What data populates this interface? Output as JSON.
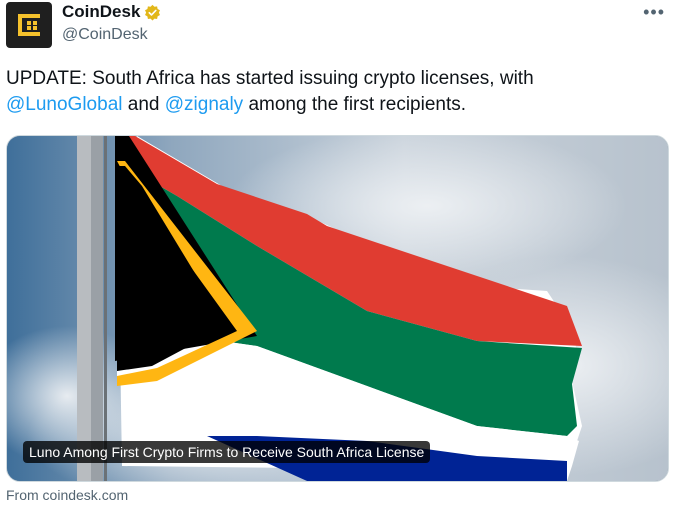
{
  "author": {
    "name": "CoinDesk",
    "handle": "@CoinDesk"
  },
  "tweet": {
    "text_part1": "UPDATE: South Africa has started issuing crypto licenses, with",
    "mention1": "@LunoGlobal",
    "text_and": "and",
    "mention2": "@zignaly",
    "text_part2": "among the first recipients."
  },
  "card": {
    "title": "Luno Among First Crypto Firms to Receive South Africa License",
    "source": "From coindesk.com"
  },
  "icons": {
    "avatar": "coindesk-logo",
    "verified": "verified-badge-icon",
    "more": "more-options-icon"
  },
  "colors": {
    "mention": "#1d9bf0",
    "verified": "#e2b719"
  }
}
